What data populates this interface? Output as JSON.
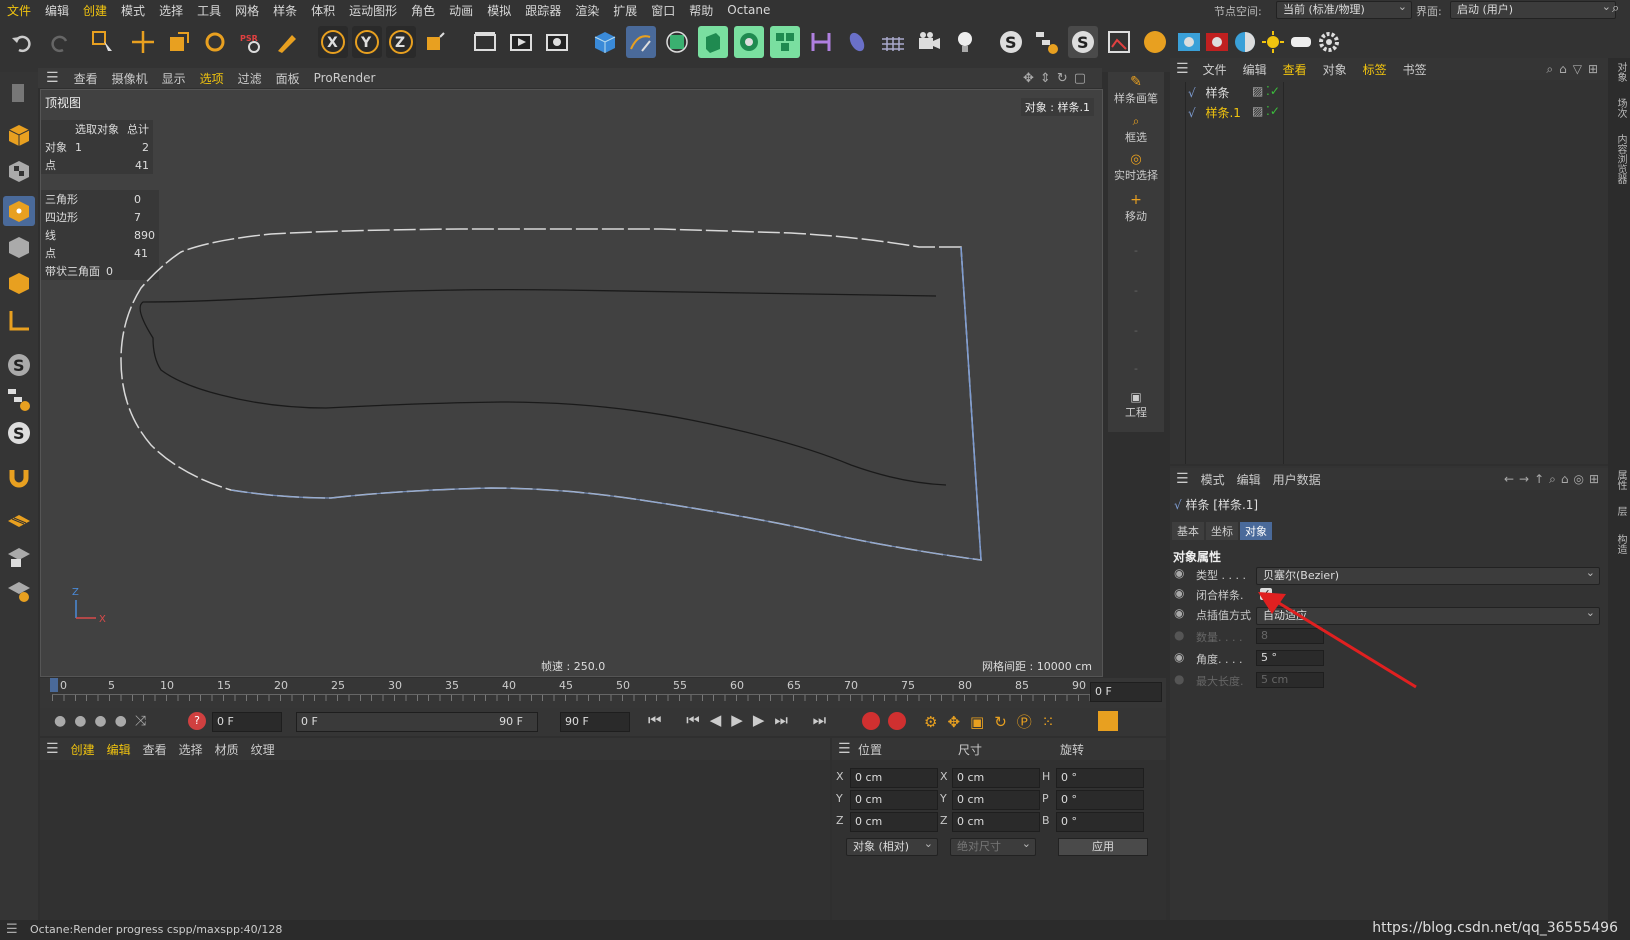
{
  "menubar": {
    "items": [
      "文件",
      "编辑",
      "创建",
      "模式",
      "选择",
      "工具",
      "网格",
      "样条",
      "体积",
      "运动图形",
      "角色",
      "动画",
      "模拟",
      "跟踪器",
      "渲染",
      "扩展",
      "窗口",
      "帮助",
      "Octane"
    ],
    "node_space_label": "节点空间:",
    "node_space_value": "当前 (标准/物理)",
    "interface_label": "界面:",
    "interface_value": "启动 (用户)"
  },
  "viewport": {
    "menu": [
      "查看",
      "摄像机",
      "显示",
      "选项",
      "过滤",
      "面板",
      "ProRender"
    ],
    "view_name": "顶视图",
    "selected_object": "对象 : 样条.1",
    "fps": "帧速 : 250.0",
    "grid_spacing": "网格间距 : 10000 cm",
    "axis_z": "Z",
    "axis_x": "X",
    "stats1": {
      "header_selected": "选取对象",
      "header_total": "总计",
      "rows": [
        {
          "label": "对象",
          "selected": "1",
          "total": "2"
        },
        {
          "label": "点",
          "selected": "",
          "total": "41"
        }
      ]
    },
    "stats2": [
      {
        "label": "三角形",
        "value": "0"
      },
      {
        "label": "四边形",
        "value": "7"
      },
      {
        "label": "线",
        "value": "890"
      },
      {
        "label": "点",
        "value": "41"
      },
      {
        "label": "带状三角面",
        "value": "0"
      }
    ]
  },
  "right_tools": {
    "spline_pen": "样条画笔",
    "box_select": "框选",
    "live_select": "实时选择",
    "move": "移动",
    "project": "工程"
  },
  "object_manager": {
    "menu": [
      "文件",
      "编辑",
      "查看",
      "对象",
      "标签",
      "书签"
    ],
    "objects": [
      {
        "name": "样条",
        "selected": false
      },
      {
        "name": "样条.1",
        "selected": true
      }
    ]
  },
  "attributes": {
    "menu": [
      "模式",
      "编辑",
      "用户数据"
    ],
    "title": "样条 [样条.1]",
    "tabs": [
      "基本",
      "坐标",
      "对象"
    ],
    "active_tab": "对象",
    "section": "对象属性",
    "props": {
      "type_label": "类型 . . . .",
      "type_value": "贝塞尔(Bezier)",
      "closed_label": "闭合样条.",
      "interp_label": "点插值方式",
      "interp_value": "自动适应",
      "count_label": "数量. . . .",
      "count_value": "8",
      "angle_label": "角度. . . .",
      "angle_value": "5 °",
      "maxlen_label": "最大长度.",
      "maxlen_value": "5 cm"
    },
    "closed_checked": true
  },
  "vertical_tabs": [
    "对象",
    "场次",
    "内容浏览器",
    "属性",
    "层",
    "构造"
  ],
  "timeline": {
    "ticks": [
      "0",
      "5",
      "10",
      "15",
      "20",
      "25",
      "30",
      "35",
      "40",
      "45",
      "50",
      "55",
      "60",
      "65",
      "70",
      "75",
      "80",
      "85",
      "90"
    ],
    "current": "0 F"
  },
  "playback": {
    "start": "0 F",
    "range_start": "0 F",
    "range_end": "90 F",
    "end": "90 F"
  },
  "material_manager": {
    "menu": [
      "创建",
      "编辑",
      "查看",
      "选择",
      "材质",
      "纹理"
    ]
  },
  "coordinates": {
    "headers": [
      "位置",
      "尺寸",
      "旋转"
    ],
    "rows": [
      {
        "axis": "X",
        "pos": "0 cm",
        "size_axis": "X",
        "size": "0 cm",
        "rot_axis": "H",
        "rot": "0 °"
      },
      {
        "axis": "Y",
        "pos": "0 cm",
        "size_axis": "Y",
        "size": "0 cm",
        "rot_axis": "P",
        "rot": "0 °"
      },
      {
        "axis": "Z",
        "pos": "0 cm",
        "size_axis": "Z",
        "size": "0 cm",
        "rot_axis": "B",
        "rot": "0 °"
      }
    ],
    "mode": "对象 (相对)",
    "size_mode": "绝对尺寸",
    "apply": "应用"
  },
  "status": {
    "text": "Octane:Render progress  cspp/maxspp:40/128",
    "watermark": "https://blog.csdn.net/qq_36555496"
  },
  "colors": {
    "accent": "#f1c40f",
    "spline_blue": "#7d9bd0",
    "annotation_arrow": "#e02020"
  }
}
